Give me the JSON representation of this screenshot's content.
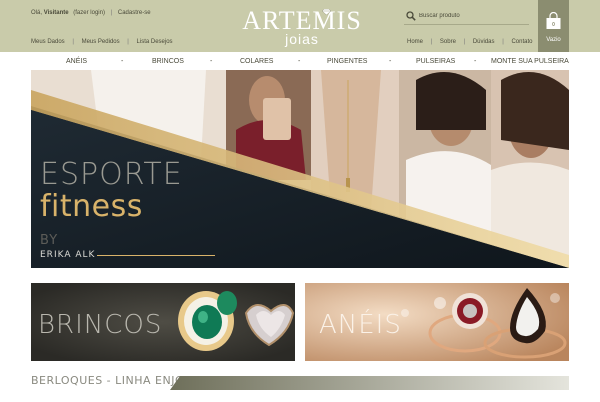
{
  "header": {
    "greeting": "Olá,",
    "visitor": "Visitante",
    "login_link": "(fazer login)",
    "register_link": "Cadastre-se",
    "account_links": [
      "Meus Dados",
      "Meus Pedidos",
      "Lista Desejos"
    ],
    "logo_main": "ARTEMIS",
    "logo_sub": "joias",
    "search_placeholder": "Buscar produto",
    "nav_links": [
      "Home",
      "Sobre",
      "Dúvidas",
      "Contato"
    ],
    "cart_count": "0",
    "cart_label": "Vazio",
    "colors": {
      "bar": "#c9cbaa",
      "cart": "#8b8d70"
    }
  },
  "category_nav": {
    "items": [
      "ANÉIS",
      "BRINCOS",
      "COLARES",
      "PINGENTES",
      "PULSEIRAS",
      "MONTE SUA PULSEIRA"
    ],
    "separator": "-"
  },
  "hero": {
    "title_line1": "ESPORTE",
    "title_line2": "fitness",
    "by": "BY",
    "author": "ERIKA ALK",
    "slide_count": 3,
    "active_slide": 1
  },
  "banners": {
    "left_label": "BRINCOS",
    "right_label": "ANÉIS"
  },
  "section": {
    "title": "BERLOQUES - LINHA ENJOY"
  },
  "icons": {
    "search": "search-icon",
    "cart": "shopping-bag-icon",
    "diamond": "diamond-icon"
  }
}
